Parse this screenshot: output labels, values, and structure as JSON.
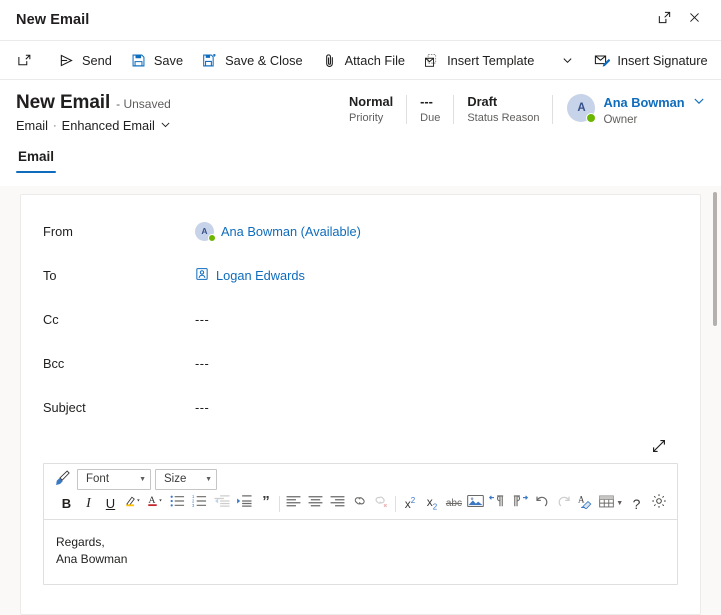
{
  "window": {
    "title": "New Email",
    "popout_icon": "pop-out-icon",
    "close_icon": "close-icon"
  },
  "commandbar": {
    "new_label": "",
    "items": [
      {
        "label": "Send",
        "icon": "send-icon"
      },
      {
        "label": "Save",
        "icon": "save-icon"
      },
      {
        "label": "Save & Close",
        "icon": "save-and-close-icon"
      },
      {
        "label": "Attach File",
        "icon": "paperclip-icon"
      },
      {
        "label": "Insert Template",
        "icon": "insert-template-icon"
      },
      {
        "label": "Insert Signature",
        "icon": "insert-signature-icon"
      }
    ],
    "overflow_label": "⋮"
  },
  "record_header": {
    "title": "New Email",
    "unsaved": "- Unsaved",
    "entity": "Email",
    "separator": "·",
    "form_name": "Enhanced Email",
    "stats": [
      {
        "value": "Normal",
        "label": "Priority"
      },
      {
        "value": "---",
        "label": "Due"
      },
      {
        "value": "Draft",
        "label": "Status Reason"
      }
    ],
    "owner": {
      "initials": "A",
      "name": "Ana Bowman",
      "role": "Owner"
    }
  },
  "tabs": [
    {
      "label": "Email",
      "active": true
    }
  ],
  "form": {
    "fields": [
      {
        "label": "From",
        "value": "Ana Bowman (Available)",
        "type": "person",
        "initials": "A"
      },
      {
        "label": "To",
        "value": "Logan Edwards",
        "type": "contact"
      },
      {
        "label": "Cc",
        "value": "---",
        "type": "empty"
      },
      {
        "label": "Bcc",
        "value": "---",
        "type": "empty"
      },
      {
        "label": "Subject",
        "value": "---",
        "type": "empty"
      }
    ]
  },
  "editor": {
    "expand_icon": "expand-diagonal-icon",
    "format_painter": "format-painter-icon",
    "font_label": "Font",
    "size_label": "Size",
    "buttons": [
      {
        "name": "bold",
        "glyph": "B"
      },
      {
        "name": "italic",
        "glyph": "I"
      },
      {
        "name": "underline",
        "glyph": "U"
      },
      {
        "name": "highlight-color",
        "glyph": ""
      },
      {
        "name": "font-color",
        "glyph": "A"
      },
      {
        "name": "bulleted-list",
        "glyph": ""
      },
      {
        "name": "numbered-list",
        "glyph": ""
      },
      {
        "name": "decrease-indent",
        "glyph": ""
      },
      {
        "name": "increase-indent",
        "glyph": ""
      },
      {
        "name": "blockquote",
        "glyph": "”"
      },
      {
        "name": "align-left",
        "glyph": ""
      },
      {
        "name": "align-center",
        "glyph": ""
      },
      {
        "name": "align-right",
        "glyph": ""
      },
      {
        "name": "insert-link",
        "glyph": ""
      },
      {
        "name": "remove-link",
        "glyph": ""
      },
      {
        "name": "superscript",
        "glyph": "x²"
      },
      {
        "name": "subscript",
        "glyph": "x₂"
      },
      {
        "name": "strikethrough",
        "glyph": "abc"
      },
      {
        "name": "insert-image",
        "glyph": ""
      },
      {
        "name": "left-to-right",
        "glyph": ""
      },
      {
        "name": "right-to-left",
        "glyph": ""
      },
      {
        "name": "undo",
        "glyph": "↶"
      },
      {
        "name": "redo",
        "glyph": "↷"
      },
      {
        "name": "clear-formatting",
        "glyph": ""
      },
      {
        "name": "insert-table",
        "glyph": ""
      },
      {
        "name": "help",
        "glyph": "?"
      },
      {
        "name": "settings",
        "glyph": ""
      }
    ],
    "body_lines": [
      "Regards,",
      "Ana Bowman"
    ]
  },
  "colors": {
    "accent": "#0f6cbd",
    "presence_available": "#6bb700",
    "canvas": "#faf9f8",
    "border": "#edebe9"
  }
}
